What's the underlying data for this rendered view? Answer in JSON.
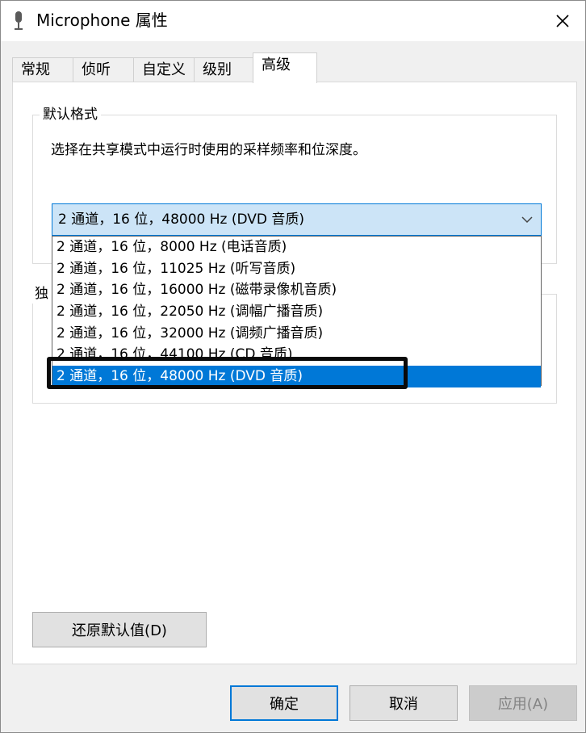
{
  "window": {
    "title": "Microphone 属性",
    "close_glyph": "✕"
  },
  "tabs": [
    {
      "label": "常规"
    },
    {
      "label": "侦听"
    },
    {
      "label": "自定义"
    },
    {
      "label": "级别"
    },
    {
      "label": "高级"
    }
  ],
  "active_tab": "高级",
  "default_format": {
    "legend": "默认格式",
    "description": "选择在共享模式中运行时使用的采样频率和位深度。",
    "selected_value": "2 通道，16 位，48000 Hz (DVD 音质)",
    "options": [
      "2 通道，16 位，8000 Hz (电话音质)",
      "2 通道，16 位，11025 Hz (听写音质)",
      "2 通道，16 位，16000 Hz (磁带录像机音质)",
      "2 通道，16 位，22050 Hz (调幅广播音质)",
      "2 通道，16 位，32000 Hz (调频广播音质)",
      "2 通道，16 位，44100 Hz (CD 音质)",
      "2 通道，16 位，48000 Hz (DVD 音质)"
    ]
  },
  "exclusive_mode": {
    "legend": "独"
  },
  "buttons": {
    "restore_defaults": "还原默认值(D)",
    "ok": "确定",
    "cancel": "取消",
    "apply": "应用(A)"
  },
  "colors": {
    "accent": "#0078d7",
    "combo_bg": "#cce4f7",
    "annotation_box": "#0a0a0a"
  }
}
